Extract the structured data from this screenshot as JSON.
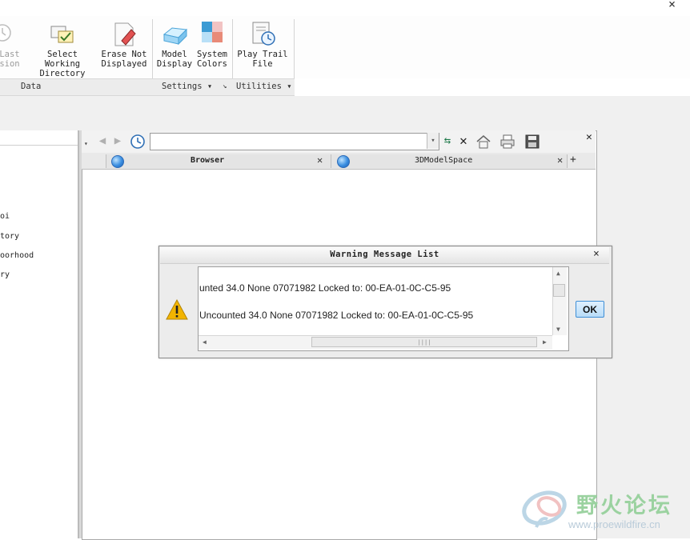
{
  "topbar": {
    "close_glyph": "×"
  },
  "ribbon": {
    "buttons": [
      {
        "label1": "Last",
        "label2": "sion",
        "icon": "trail-file-icon"
      },
      {
        "label1": "Select Working",
        "label2": "Directory",
        "icon": "folder-check-icon"
      },
      {
        "label1": "Erase Not",
        "label2": "Displayed",
        "icon": "eraser-icon"
      },
      {
        "label1": "Model",
        "label2": "Display",
        "icon": "model-display-icon"
      },
      {
        "label1": "System",
        "label2": "Colors",
        "icon": "system-colors-icon"
      },
      {
        "label1": "Play Trail",
        "label2": "File",
        "icon": "play-trail-icon"
      }
    ],
    "groups": {
      "data": "Data",
      "settings": "Settings ▾",
      "utilities": "Utilities ▾"
    }
  },
  "tree": {
    "items": [
      "oi",
      "tory",
      "oorhood",
      "ry"
    ]
  },
  "browser": {
    "address_value": "",
    "tabs": [
      {
        "label": "Browser",
        "icon": "globe-icon"
      },
      {
        "label": "3DModelSpace",
        "icon": "globe-icon"
      }
    ],
    "add_tab": "+"
  },
  "dialog": {
    "title": "Warning Message List",
    "close_glyph": "×",
    "messages": [
      "unted      34.0        None        07071982 Locked to: 00-EA-01-0C-C5-95",
      "Uncounted      34.0        None        07071982 Locked to: 00-EA-01-0C-C5-95"
    ],
    "ok_label": "OK"
  },
  "watermark": {
    "cn_text": "野火论坛",
    "url": "www.proewildfire.cn"
  },
  "colors": {
    "ok_border": "#3f8fd6",
    "warning": "#f2b400",
    "watermark_green": "#9bd2a0"
  }
}
